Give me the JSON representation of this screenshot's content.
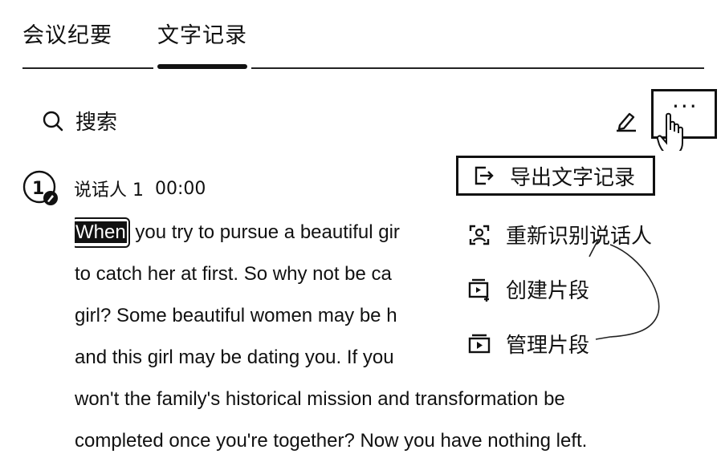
{
  "tabs": [
    {
      "label": "会议纪要",
      "active": false
    },
    {
      "label": "文字记录",
      "active": true
    }
  ],
  "search": {
    "label": "搜索"
  },
  "toolbar": {
    "more_label": "···",
    "icons": [
      "search-icon",
      "edit-icon",
      "more-icon",
      "hand-cursor-icon"
    ]
  },
  "speaker": {
    "name": "说话人 1",
    "time": "00:00"
  },
  "transcript": {
    "highlight_word": "When",
    "line1_rest": " you try to pursue a beautiful gir",
    "line2": "to catch her at first. So why not be ca",
    "line3": "girl? Some beautiful women may be h",
    "line4": "and this girl may be dating you. If you",
    "line5": "won't the family's historical mission and transformation be",
    "line6": "completed once you're together? Now you have nothing left."
  },
  "menu": {
    "items": [
      {
        "label": "导出文字记录",
        "icon": "export-icon"
      },
      {
        "label": "重新识别说话人",
        "icon": "face-scan-icon"
      },
      {
        "label": "创建片段",
        "icon": "create-clip-icon"
      },
      {
        "label": "管理片段",
        "icon": "manage-clip-icon"
      }
    ]
  },
  "colors": {
    "text": "#111111",
    "background": "#ffffff",
    "highlight": "#111111"
  }
}
